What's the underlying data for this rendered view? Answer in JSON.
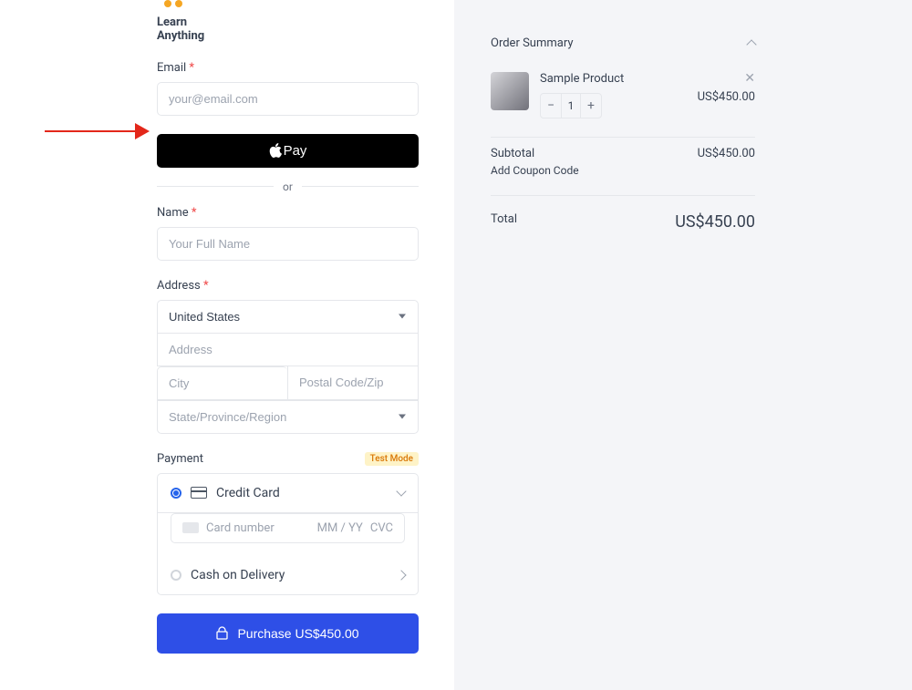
{
  "logo": {
    "line1": "Learn",
    "line2": "Anything"
  },
  "email": {
    "label": "Email",
    "placeholder": "your@email.com"
  },
  "applePay": {
    "label": "Pay"
  },
  "or": "or",
  "name": {
    "label": "Name",
    "placeholder": "Your Full Name"
  },
  "address": {
    "label": "Address",
    "country": "United States",
    "addressPlaceholder": "Address",
    "cityPlaceholder": "City",
    "postalPlaceholder": "Postal Code/Zip",
    "statePlaceholder": "State/Province/Region"
  },
  "payment": {
    "label": "Payment",
    "badge": "Test Mode",
    "creditCard": "Credit Card",
    "cardNumberPlaceholder": "Card number",
    "expPlaceholder": "MM / YY",
    "cvcPlaceholder": "CVC",
    "cod": "Cash on Delivery"
  },
  "purchase": {
    "label": "Purchase US$450.00"
  },
  "summary": {
    "title": "Order Summary",
    "product": {
      "name": "Sample Product",
      "qty": "1",
      "price": "US$450.00"
    },
    "subtotalLabel": "Subtotal",
    "subtotalValue": "US$450.00",
    "couponLabel": "Add Coupon Code",
    "totalLabel": "Total",
    "totalValue": "US$450.00"
  }
}
